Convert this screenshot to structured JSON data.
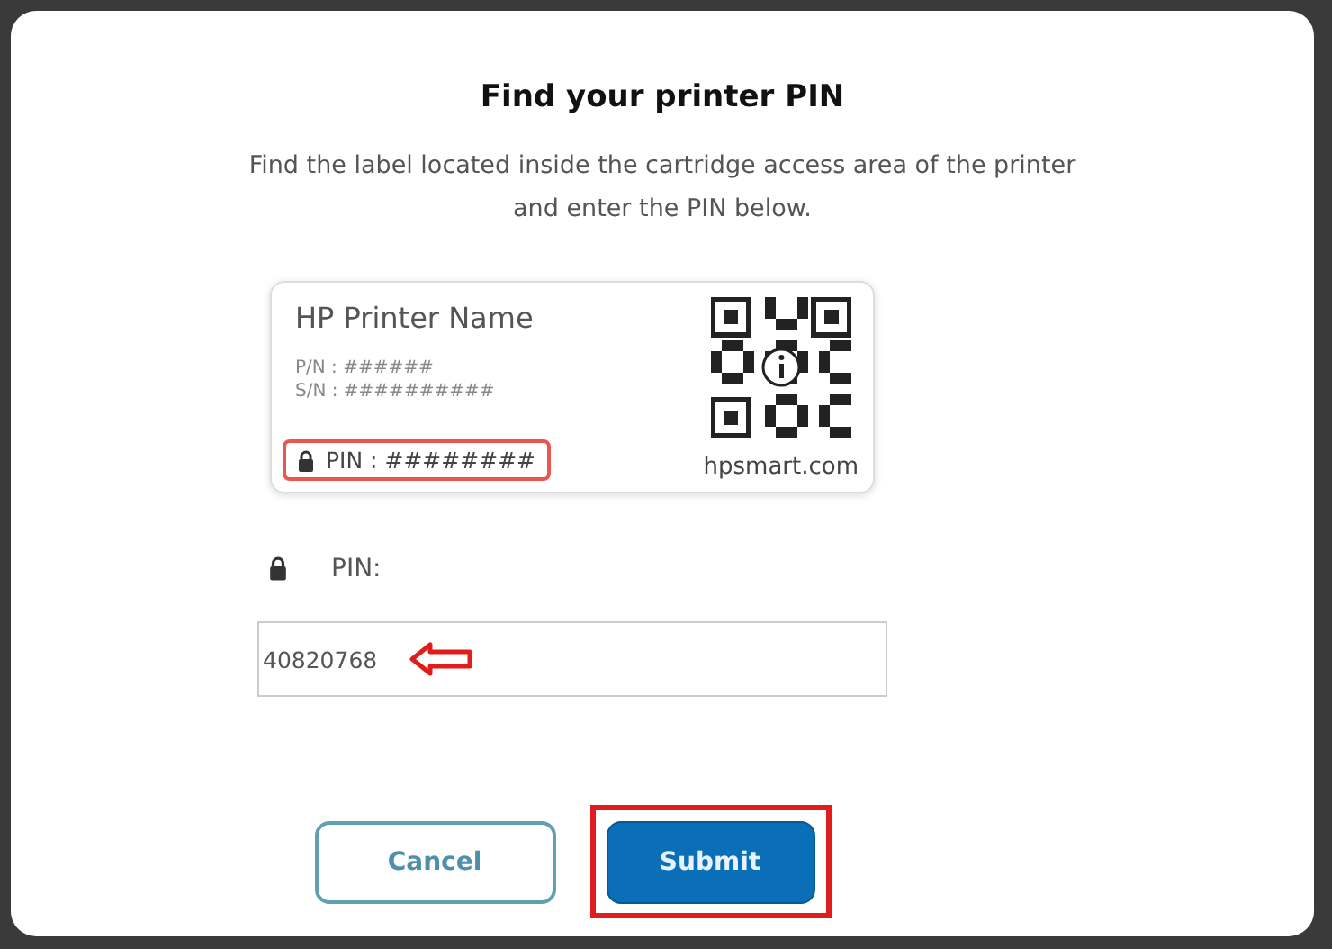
{
  "dialog": {
    "title": "Find your printer PIN",
    "description": "Find the label located inside the cartridge access area of the printer and enter the PIN below."
  },
  "label_card": {
    "printer_name": "HP Printer Name",
    "lines": [
      "P/N : ######",
      "S/N : ##########"
    ],
    "pin_text": "PIN : ########",
    "website": "hpsmart.com"
  },
  "pin_field": {
    "label": "PIN:",
    "value": "40820768"
  },
  "buttons": [
    {
      "label": "Cancel",
      "kind": "secondary"
    },
    {
      "label": "Submit",
      "kind": "primary"
    }
  ]
}
